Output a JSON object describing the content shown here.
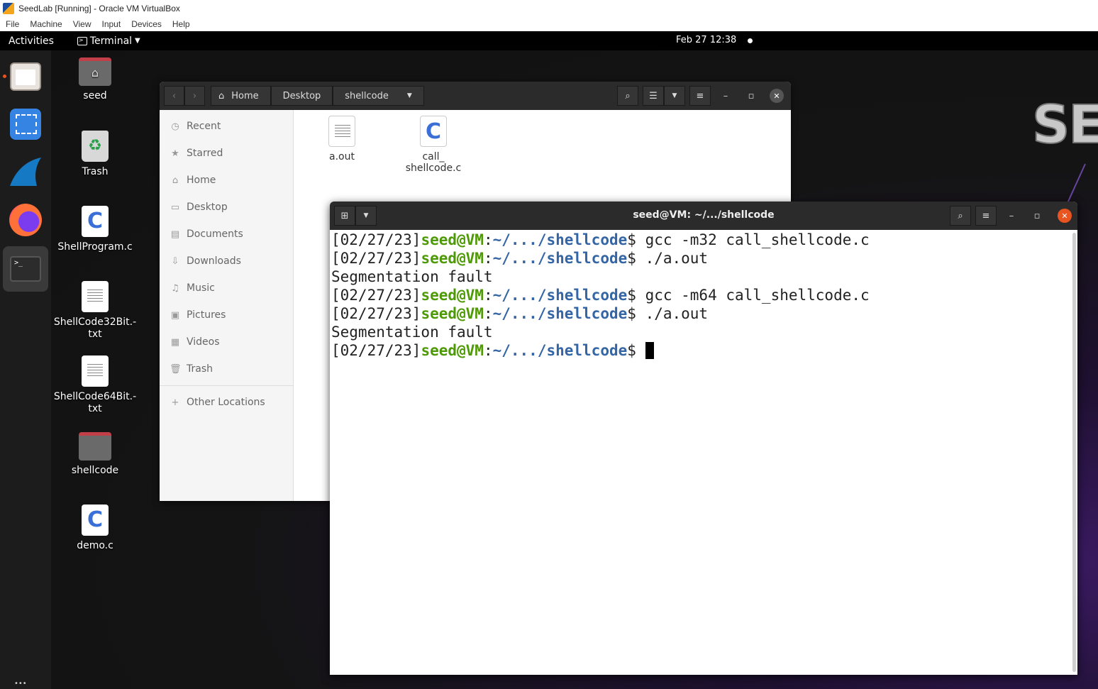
{
  "host": {
    "title": "SeedLab [Running] - Oracle VM VirtualBox",
    "menu": [
      "File",
      "Machine",
      "View",
      "Input",
      "Devices",
      "Help"
    ]
  },
  "topbar": {
    "activities": "Activities",
    "app_name": "Terminal",
    "clock": "Feb 27  12:38"
  },
  "desktop": {
    "logo_text": "SE",
    "icons": [
      "seed",
      "Trash",
      "ShellProgram.c",
      "ShellCode32Bit.-txt",
      "ShellCode64Bit.-txt",
      "shellcode",
      "demo.c"
    ],
    "icon_label_lines": {
      "sc32": [
        "ShellCode32Bit.-",
        "txt"
      ],
      "sc64": [
        "ShellCode64Bit.-",
        "txt"
      ]
    }
  },
  "files": {
    "path": [
      "Home",
      "Desktop",
      "shellcode"
    ],
    "sidebar": [
      "Recent",
      "Starred",
      "Home",
      "Desktop",
      "Documents",
      "Downloads",
      "Music",
      "Pictures",
      "Videos",
      "Trash",
      "Other Locations"
    ],
    "items": [
      {
        "name_lines": [
          "a.out"
        ],
        "type": "binary"
      },
      {
        "name_lines": [
          "call_",
          "shellcode.c"
        ],
        "type": "c-source"
      }
    ]
  },
  "terminal": {
    "title": "seed@VM: ~/.../shellcode",
    "lines": [
      {
        "kind": "prompt",
        "time": "[02/27/23]",
        "user": "seed@VM",
        "sep": ":",
        "path": "~/.../shellcode",
        "dollar": "$ ",
        "cmd": "gcc -m32 call_shellcode.c"
      },
      {
        "kind": "prompt",
        "time": "[02/27/23]",
        "user": "seed@VM",
        "sep": ":",
        "path": "~/.../shellcode",
        "dollar": "$ ",
        "cmd": "./a.out"
      },
      {
        "kind": "output",
        "text": "Segmentation fault"
      },
      {
        "kind": "prompt",
        "time": "[02/27/23]",
        "user": "seed@VM",
        "sep": ":",
        "path": "~/.../shellcode",
        "dollar": "$ ",
        "cmd": "gcc -m64 call_shellcode.c"
      },
      {
        "kind": "prompt",
        "time": "[02/27/23]",
        "user": "seed@VM",
        "sep": ":",
        "path": "~/.../shellcode",
        "dollar": "$ ",
        "cmd": "./a.out"
      },
      {
        "kind": "output",
        "text": "Segmentation fault"
      },
      {
        "kind": "prompt",
        "time": "[02/27/23]",
        "user": "seed@VM",
        "sep": ":",
        "path": "~/.../shellcode",
        "dollar": "$ ",
        "cmd": ""
      }
    ]
  },
  "colors": {
    "prompt_user": "#4e9a06",
    "prompt_path": "#3465a4",
    "accent": "#e95420"
  }
}
